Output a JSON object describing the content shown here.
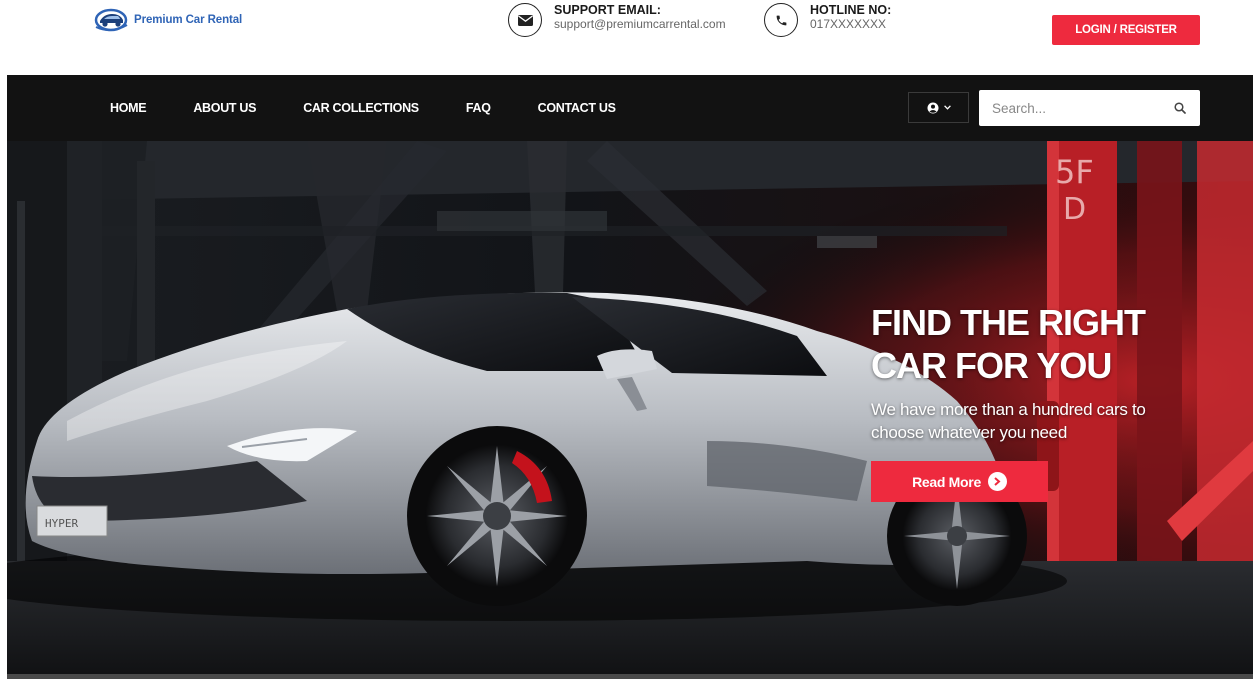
{
  "brand": {
    "name": "Premium Car Rental"
  },
  "contacts": {
    "email": {
      "label": "SUPPORT EMAIL:",
      "value": "support@premiumcarrental.com",
      "icon": "envelope-icon"
    },
    "hotline": {
      "label": "HOTLINE NO:",
      "value": "017XXXXXXX",
      "icon": "phone-icon"
    }
  },
  "auth": {
    "login_label": "LOGIN / REGISTER"
  },
  "nav": {
    "items": [
      {
        "label": "HOME"
      },
      {
        "label": "ABOUT US"
      },
      {
        "label": "CAR COLLECTIONS"
      },
      {
        "label": "FAQ"
      },
      {
        "label": "CONTACT US"
      }
    ]
  },
  "search": {
    "placeholder": "Search..."
  },
  "hero": {
    "title_line1": "FIND THE RIGHT",
    "title_line2": "CAR FOR YOU",
    "subtitle_line1": "We have more than a hundred cars to",
    "subtitle_line2": "choose whatever you need",
    "cta_label": "Read More",
    "floor_sign_level": "5F",
    "floor_sign_zone": "D",
    "plate_text": "HYPER"
  },
  "colors": {
    "accent": "#ee2a3e",
    "nav_bg": "#121212",
    "brand_blue": "#2f64b6"
  }
}
